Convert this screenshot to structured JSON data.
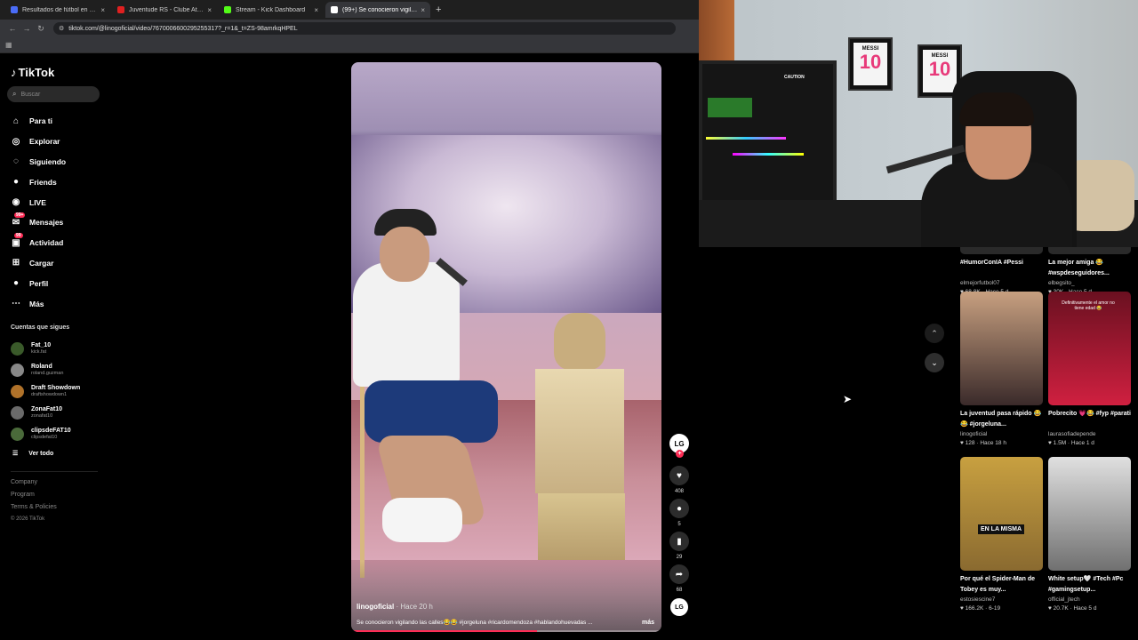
{
  "browser": {
    "tabs": [
      {
        "title": "Resultados de fútbol en directo",
        "color": "#4a6cf7",
        "active": false
      },
      {
        "title": "Juventude RS - Clube Atletico M...",
        "color": "#e02020",
        "active": false
      },
      {
        "title": "Stream - Kick Dashboard",
        "color": "#53fc18",
        "active": false
      },
      {
        "title": "(99+) Se conocieron vigilan...",
        "color": "#ffffff",
        "active": true
      }
    ],
    "new_tab": "+",
    "url": "tiktok.com/@linogoficial/video/7670006600295255317?_r=1&_t=ZS-98amrkqHPEL"
  },
  "tiktok": {
    "logo_text": "TikTok",
    "search_placeholder": "Buscar",
    "nav": [
      {
        "label": "Para ti",
        "icon": "home-icon",
        "glyph": "⌂"
      },
      {
        "label": "Explorar",
        "icon": "compass-icon",
        "glyph": "◎"
      },
      {
        "label": "Siguiendo",
        "icon": "following-icon",
        "glyph": "◌"
      },
      {
        "label": "Friends",
        "icon": "friends-icon",
        "glyph": "●"
      },
      {
        "label": "LIVE",
        "icon": "live-icon",
        "glyph": "◉"
      },
      {
        "label": "Mensajes",
        "icon": "messages-icon",
        "glyph": "✉",
        "badge": "99+"
      },
      {
        "label": "Actividad",
        "icon": "activity-icon",
        "glyph": "▣",
        "badge": "99"
      },
      {
        "label": "Cargar",
        "icon": "upload-icon",
        "glyph": "⊞"
      },
      {
        "label": "Perfil",
        "icon": "profile-icon",
        "glyph": "●"
      },
      {
        "label": "Más",
        "icon": "more-icon",
        "glyph": "⋯"
      }
    ],
    "following_header": "Cuentas que sigues",
    "following": [
      {
        "name": "Fat_10",
        "handle": "kick.fat",
        "color": "#3a5a2a"
      },
      {
        "name": "Roland",
        "handle": "roland.guzman",
        "color": "#888888"
      },
      {
        "name": "Draft Showdown",
        "handle": "draftshowdown1",
        "color": "#b0722a"
      },
      {
        "name": "ZonaFat10",
        "handle": "zonafat10",
        "color": "#6a6a6a"
      },
      {
        "name": "clipsdeFAT10",
        "handle": "clipsdefat10",
        "color": "#4a6a3a"
      }
    ],
    "see_all": "Ver todo",
    "footer": [
      "Company",
      "Program",
      "Terms & Policies"
    ],
    "copyright": "© 2026 TikTok"
  },
  "video": {
    "author": "linogoficial",
    "ago": " · Hace 20 h",
    "description": "Se conocieron vigilando las calles😂😂 #jorgeluna #ricardomendoza #hablandohuevadas ...",
    "more": "más",
    "progress": 0.6,
    "creator_avatar": "LG",
    "follow_plus": "+",
    "likes": "408",
    "comments": "5",
    "saves": "29",
    "shares": "68"
  },
  "webcam": {
    "frame1_top": "MESSI",
    "frame1_num": "10",
    "frame2_top": "MESSI",
    "frame2_num": "10",
    "case_label": "CAUTION"
  },
  "recommendations": [
    {
      "title": "#HumorConIA #Pessi",
      "author": "elmejorfutbol07",
      "likes": "68.8K",
      "ago": "Hace 5 d",
      "colors": [
        "#2a2a2a",
        "#2a2a2a"
      ]
    },
    {
      "title": "La mejor amiga 😂 #wspdeseguidores...",
      "author": "elbegsito_",
      "likes": "30K",
      "ago": "Hace 5 d",
      "colors": [
        "#2a2a2a",
        "#2a2a2a"
      ]
    },
    {
      "title": "La juventud pasa rápido 😂😂 #jorgeluna...",
      "author": "linogoficial",
      "likes": "128",
      "ago": "Hace 18 h",
      "colors": [
        "#c8a080",
        "#3a2a2a"
      ]
    },
    {
      "title": "Pobrecito 💗😂 #fyp #parati",
      "author": "laurasofiadepende",
      "likes": "1.5M",
      "ago": "Hace 1 d",
      "colors": [
        "#6a1020",
        "#d02040"
      ],
      "overlay": "Definitivamente el amor no tiene edad 😂"
    },
    {
      "title": "Por qué el Spider-Man de Tobey es muy...",
      "author": "estosiescine7",
      "likes": "166.2K",
      "ago": "6-19",
      "colors": [
        "#c8a040",
        "#8a6a30"
      ],
      "label": "EN LA MISMA"
    },
    {
      "title": "White setup🤍 #Tech #Pc #gamingsetup...",
      "author": "official_jtech",
      "likes": "20.7K",
      "ago": "Hace 5 d",
      "colors": [
        "#e0e0e0",
        "#707070"
      ]
    }
  ],
  "icons": {
    "up": "⌃",
    "down": "⌄",
    "heart": "♥"
  }
}
